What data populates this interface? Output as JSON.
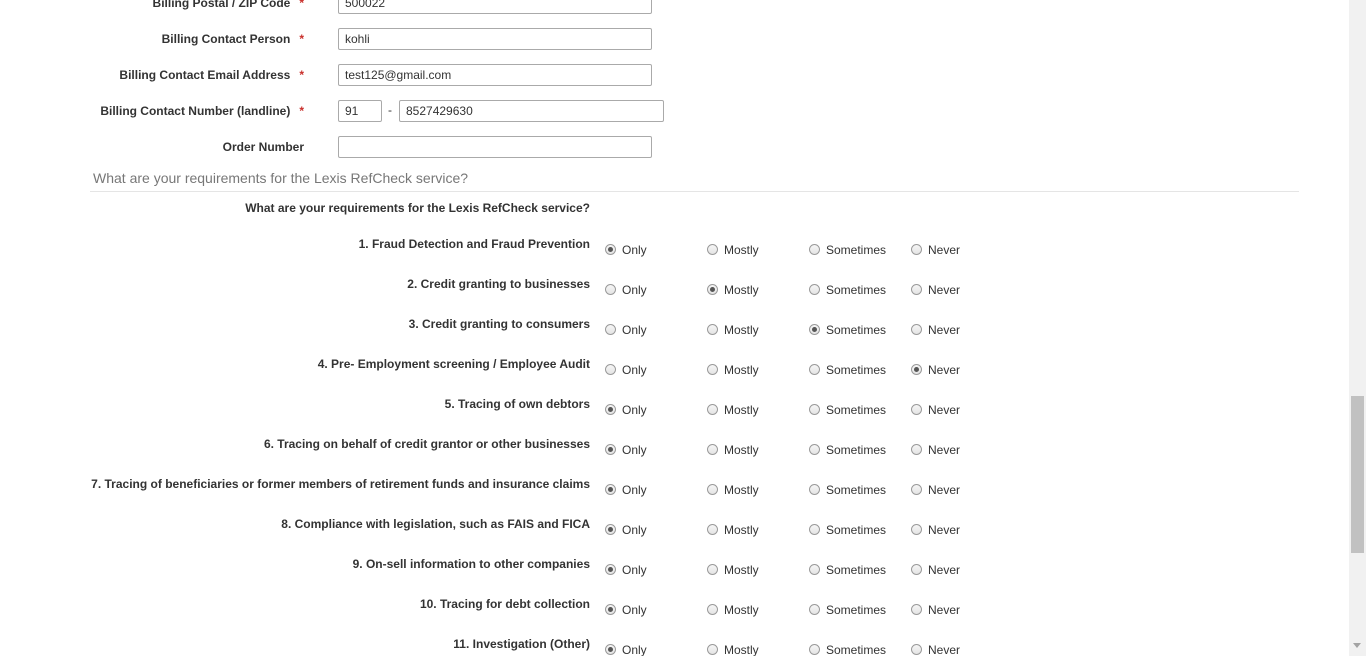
{
  "billing": {
    "postal_label": "Billing Postal / ZIP Code",
    "postal_value": "500022",
    "contact_person_label": "Billing Contact Person",
    "contact_person_value": "kohli",
    "email_label": "Billing Contact Email Address",
    "email_value": "test125@gmail.com",
    "phone_label": "Billing Contact Number (landline)",
    "phone_code": "91",
    "phone_separator": "-",
    "phone_number": "8527429630",
    "order_label": "Order Number",
    "order_value": "",
    "required_marker": "*"
  },
  "requirements": {
    "section_title": "What are your requirements for the Lexis RefCheck service?",
    "question_heading": "What are your requirements for the Lexis RefCheck service?",
    "options": [
      "Only",
      "Mostly",
      "Sometimes",
      "Never"
    ],
    "questions": [
      {
        "label": "1. Fraud Detection and Fraud Prevention",
        "selected": "Only"
      },
      {
        "label": "2. Credit granting to businesses",
        "selected": "Mostly"
      },
      {
        "label": "3. Credit granting to consumers",
        "selected": "Sometimes"
      },
      {
        "label": "4. Pre- Employment screening / Employee Audit",
        "selected": "Never"
      },
      {
        "label": "5. Tracing of own debtors",
        "selected": "Only"
      },
      {
        "label": "6. Tracing on behalf of credit grantor or other businesses",
        "selected": "Only"
      },
      {
        "label": "7. Tracing of beneficiaries or former members of retirement funds and insurance claims",
        "selected": "Only"
      },
      {
        "label": "8. Compliance with legislation, such as FAIS and FICA",
        "selected": "Only"
      },
      {
        "label": "9. On-sell information to other companies",
        "selected": "Only"
      },
      {
        "label": "10. Tracing for debt collection",
        "selected": "Only"
      },
      {
        "label": "11. Investigation (Other)",
        "selected": "Only"
      }
    ]
  }
}
